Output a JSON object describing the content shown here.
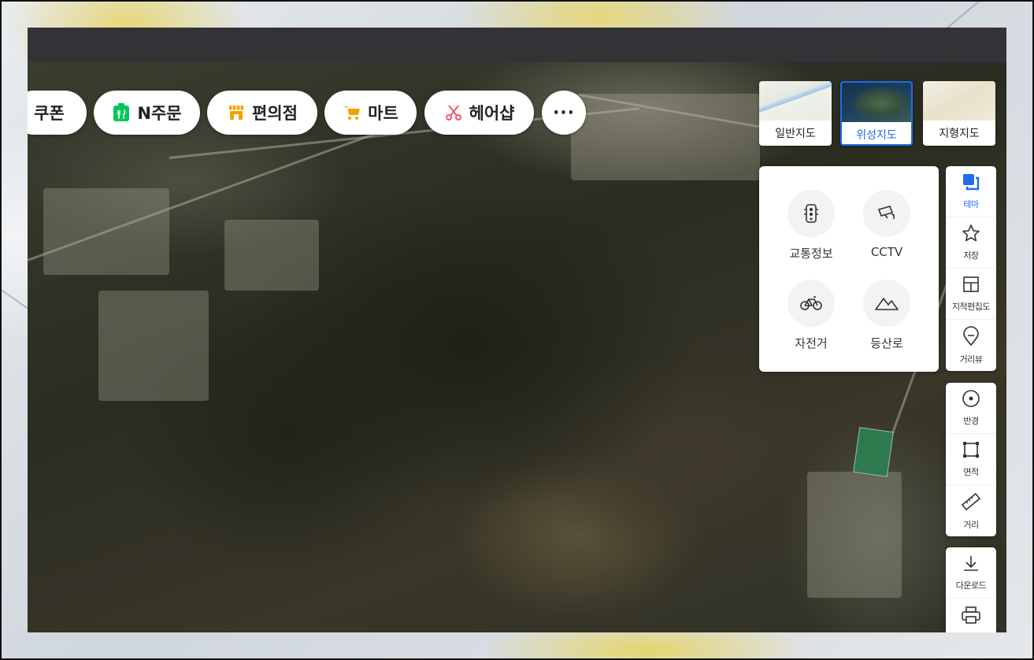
{
  "categories": [
    {
      "label": "쿠폰",
      "icon": ""
    },
    {
      "label": "N주문",
      "icon": "order-icon",
      "color": "#03c75a"
    },
    {
      "label": "편의점",
      "icon": "convenience-store-icon",
      "color": "#f5a300"
    },
    {
      "label": "마트",
      "icon": "cart-icon",
      "color": "#f5a300"
    },
    {
      "label": "헤어샵",
      "icon": "scissors-icon",
      "color": "#f0566f"
    },
    {
      "label": "",
      "icon": "more-icon"
    }
  ],
  "more_label": "···",
  "map_types": [
    {
      "label": "일반지도",
      "active": false
    },
    {
      "label": "위성지도",
      "active": true
    },
    {
      "label": "지형지도",
      "active": false
    }
  ],
  "theme_panel": [
    {
      "label": "교통정보",
      "icon": "traffic-light-icon"
    },
    {
      "label": "CCTV",
      "icon": "cctv-icon"
    },
    {
      "label": "자전거",
      "icon": "bicycle-icon"
    },
    {
      "label": "등산로",
      "icon": "mountain-icon"
    }
  ],
  "toolbar": {
    "group1": [
      {
        "label": "테마",
        "icon": "layers-icon",
        "active": true
      },
      {
        "label": "저장",
        "icon": "star-icon",
        "active": false
      },
      {
        "label": "지적편집도",
        "icon": "cadastral-map-icon",
        "active": false
      },
      {
        "label": "거리뷰",
        "icon": "streetview-pin-icon",
        "active": false
      }
    ],
    "group2": [
      {
        "label": "반경",
        "icon": "radius-icon"
      },
      {
        "label": "면적",
        "icon": "area-icon"
      },
      {
        "label": "거리",
        "icon": "ruler-icon"
      }
    ],
    "group3": [
      {
        "label": "다운로드",
        "icon": "download-icon"
      },
      {
        "label": "인쇄",
        "icon": "print-icon"
      }
    ]
  },
  "colors": {
    "accent": "#1f6cf0",
    "topbar": "#343237"
  }
}
